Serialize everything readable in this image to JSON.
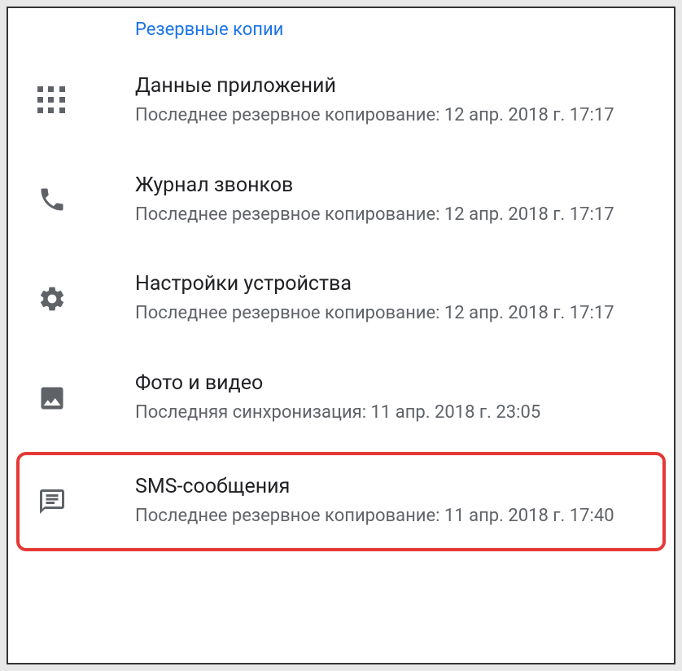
{
  "section_header": "Резервные копии",
  "items": [
    {
      "icon": "apps",
      "title": "Данные приложений",
      "subtitle": "Последнее резервное копирование: 12 апр. 2018 г. 17:17",
      "highlighted": false
    },
    {
      "icon": "phone",
      "title": "Журнал звонков",
      "subtitle": "Последнее резервное копирование: 12 апр. 2018 г. 17:17",
      "highlighted": false
    },
    {
      "icon": "settings",
      "title": "Настройки устройства",
      "subtitle": "Последнее резервное копирование: 12 апр. 2018 г. 17:17",
      "highlighted": false
    },
    {
      "icon": "photo",
      "title": "Фото и видео",
      "subtitle": "Последняя синхронизация: 11 апр. 2018 г. 23:05",
      "highlighted": false
    },
    {
      "icon": "message",
      "title": "SMS-сообщения",
      "subtitle": "Последнее резервное копирование: 11 апр. 2018 г. 17:40",
      "highlighted": true
    }
  ]
}
